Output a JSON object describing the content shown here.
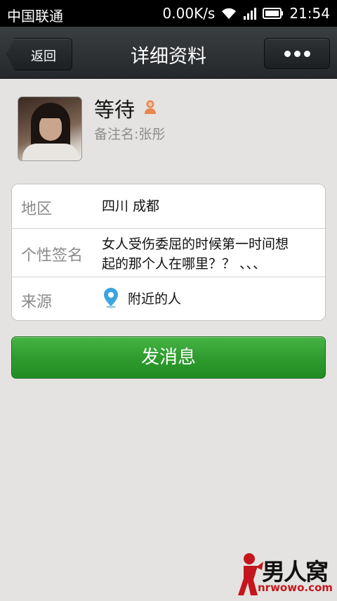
{
  "status_bar": {
    "carrier": "中国联通",
    "speed": "0.00K/s",
    "time": "21:54"
  },
  "title_bar": {
    "back_label": "返回",
    "title": "详细资料",
    "more_icon": "more-dots-icon"
  },
  "profile": {
    "nickname": "等待",
    "gender_icon": "female-user-icon",
    "remark": "备注名:张彤"
  },
  "details": {
    "region": {
      "label": "地区",
      "value": "四川  成都"
    },
    "signature": {
      "label": "个性签名",
      "value_line1": "女人受伤委屈的时候第一时间想",
      "value_line2": "起的那个人在哪里？？ 、、、"
    },
    "source": {
      "label": "来源",
      "icon": "location-pin-icon",
      "value": "附近的人"
    }
  },
  "send_button": "发消息",
  "watermark": {
    "logo_text": "男人窝",
    "url": "nrwowo.com"
  },
  "colors": {
    "accent_green": "#2f9c2f",
    "title_bar": "#2e3134",
    "background": "#e4e3e1",
    "pin_blue": "#3aa6df",
    "gender_orange": "#e8874e"
  }
}
